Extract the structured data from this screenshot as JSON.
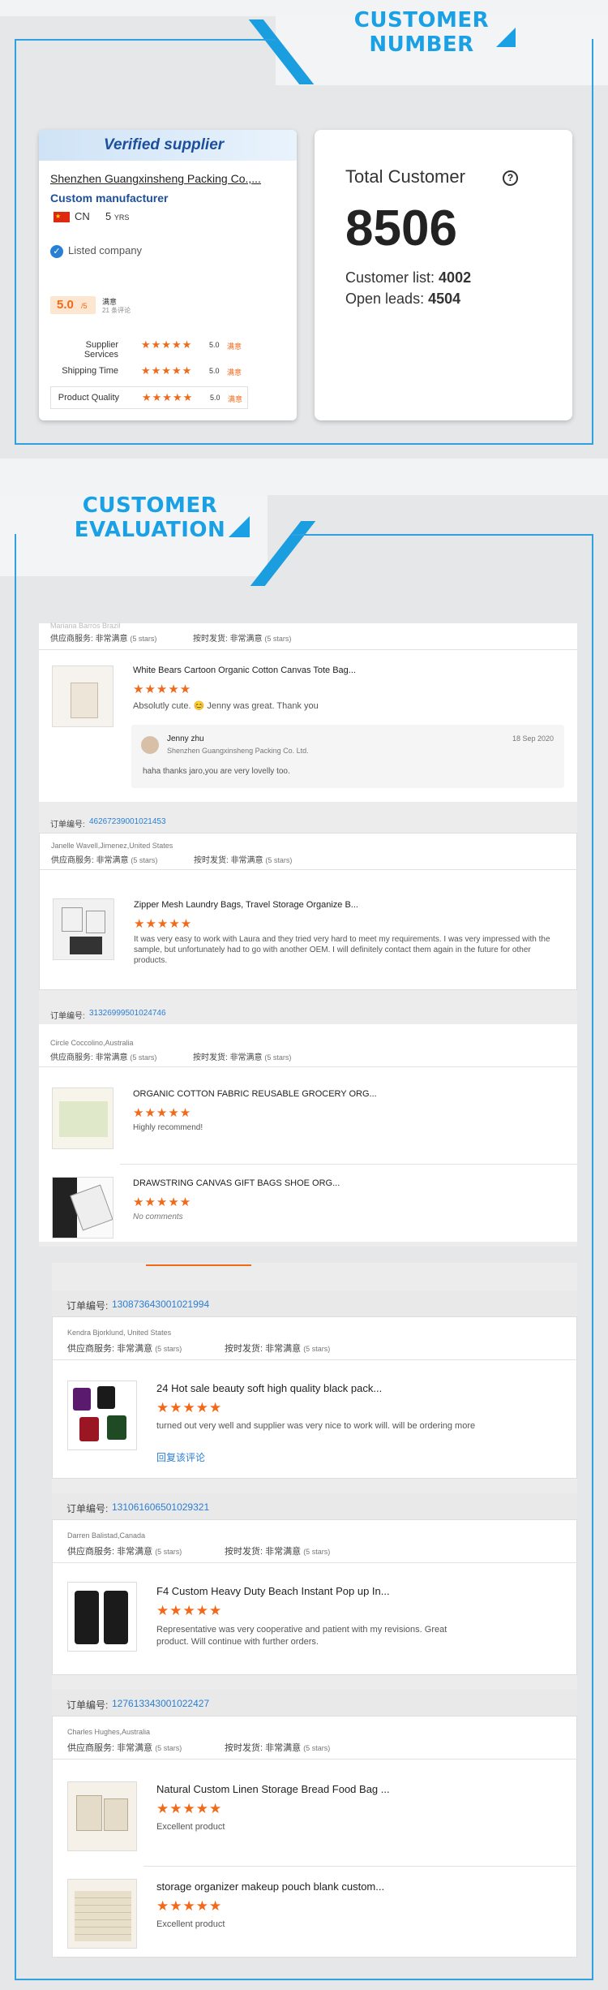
{
  "header1": {
    "line1": "CUSTOMER",
    "line2": "NUMBER"
  },
  "supplier": {
    "badge": "Verified supplier",
    "name": "Shenzhen Guangxinsheng Packing Co.,...",
    "type": "Custom manufacturer",
    "country": "CN",
    "years": "5",
    "years_unit": "YRS",
    "listed": "Listed company",
    "score": "5.0",
    "score_max": "/5",
    "score_label": "满意",
    "score_count": "21 条评论",
    "ratings": [
      {
        "label": "Supplier Services",
        "value": "5.0",
        "tag": "满意"
      },
      {
        "label": "Shipping Time",
        "value": "5.0",
        "tag": "满意"
      },
      {
        "label": "Product Quality",
        "value": "5.0",
        "tag": "满意"
      }
    ],
    "stars": "★★★★★"
  },
  "total": {
    "title": "Total Customer",
    "help_icon": "?",
    "value": "8506",
    "list_label": "Customer list:",
    "list_value": "4002",
    "leads_label": "Open leads:",
    "leads_value": "4504"
  },
  "header2": {
    "line1": "CUSTOMER",
    "line2": "EVALUATION"
  },
  "review_common": {
    "service_label": "供应商服务:",
    "service_value": "非常满意",
    "stars_note": "(5 stars)",
    "ship_label": "按时发货:",
    "ship_value": "非常满意",
    "order_label": "订单编号:",
    "stars": "★★★★★"
  },
  "block1": {
    "buyer_cut": "Mariana Barros Brazil",
    "product": "White Bears Cartoon Organic Cotton Canvas Tote Bag...",
    "comment": "Absolutly cute. 😊 Jenny was great. Thank you",
    "reply_name": "Jenny zhu",
    "reply_date": "18 Sep 2020",
    "reply_company": "Shenzhen Guangxinsheng Packing Co. Ltd.",
    "reply_text": "haha thanks jaro,you are very lovelly too."
  },
  "block2": {
    "order": "46267239001021453",
    "buyer": "Janelle Wavell,Jimenez,United States",
    "product": "Zipper Mesh Laundry Bags, Travel Storage Organize B...",
    "comment": "It was very easy to work with Laura and they tried very hard to meet my requirements. I was very impressed with the sample, but unfortunately had to go with another OEM. I will definitely contact them again in the future for other products."
  },
  "block3": {
    "order": "31326999501024746",
    "buyer": "Circle Coccolino,Australia",
    "items": [
      {
        "product": "ORGANIC COTTON FABRIC REUSABLE GROCERY ORG...",
        "comment": "Highly recommend!"
      },
      {
        "product": "DRAWSTRING CANVAS GIFT BAGS SHOE ORG...",
        "comment": "No comments"
      }
    ]
  },
  "block4": {
    "order": "130873643001021994",
    "buyer": "Kendra Bjorklund, United States",
    "product": "24 Hot sale beauty soft high quality black pack...",
    "comment": "turned out very well and supplier was very nice to work will. will be ordering more",
    "link": "回复该评论"
  },
  "block5": {
    "order": "131061606501029321",
    "buyer": "Darren Balistad,Canada",
    "product": "F4 Custom Heavy Duty Beach Instant Pop up In...",
    "comment": "Representative was very cooperative and patient with my revisions. Great product. Will continue with further orders."
  },
  "block6": {
    "order": "127613343001022427",
    "buyer": "Charles Hughes,Australia",
    "items": [
      {
        "product": "Natural Custom Linen Storage Bread Food Bag ...",
        "comment": "Excellent product"
      },
      {
        "product": "storage organizer makeup pouch blank custom...",
        "comment": "Excellent product"
      }
    ]
  }
}
